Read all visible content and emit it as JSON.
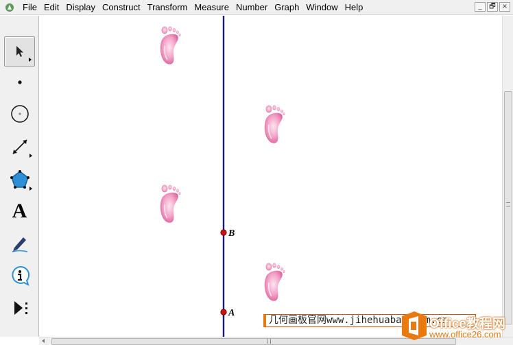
{
  "menubar": {
    "items": [
      "File",
      "Edit",
      "Display",
      "Construct",
      "Transform",
      "Measure",
      "Number",
      "Graph",
      "Window",
      "Help"
    ],
    "window_buttons": [
      "_",
      "🗗",
      "×"
    ]
  },
  "toolbox": {
    "tools": [
      {
        "name": "arrow-tool",
        "selected": true
      },
      {
        "name": "point-tool",
        "selected": false
      },
      {
        "name": "compass-tool",
        "selected": false
      },
      {
        "name": "straightedge-tool",
        "selected": false
      },
      {
        "name": "polygon-tool",
        "selected": false
      },
      {
        "name": "text-tool",
        "selected": false
      },
      {
        "name": "marker-tool",
        "selected": false
      },
      {
        "name": "information-tool",
        "selected": false
      },
      {
        "name": "custom-tool",
        "selected": false
      }
    ],
    "text_tool_glyph": "A"
  },
  "canvas": {
    "points": [
      {
        "label": "B"
      },
      {
        "label": "A"
      }
    ],
    "line_color": "#1a1a7e",
    "point_color": "#cc1111",
    "footprint_color": "#e87aae"
  },
  "watermarks": {
    "text": "几何画板官网www.jihehuaban.com.cn",
    "office_line1": "Office教程网",
    "office_line2": "www.office26.com"
  },
  "colors": {
    "chrome": "#f0f0f0",
    "accent_orange": "#e87a10"
  }
}
